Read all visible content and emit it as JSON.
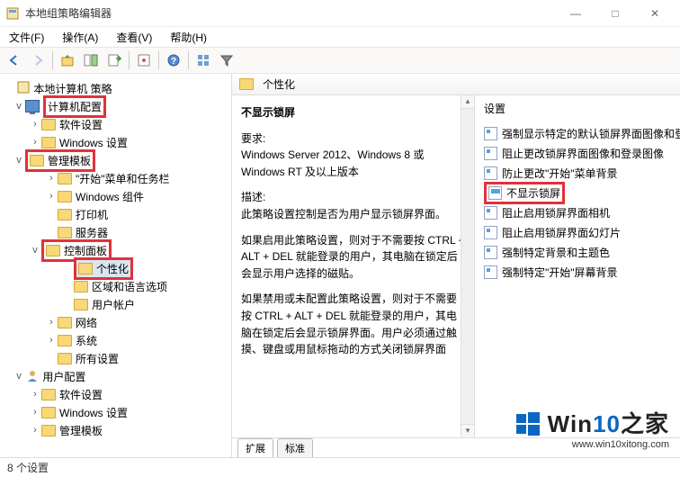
{
  "window": {
    "title": "本地组策略编辑器",
    "controls": {
      "min": "—",
      "max": "□",
      "close": "✕"
    }
  },
  "menu": {
    "file": "文件(F)",
    "action": "操作(A)",
    "view": "查看(V)",
    "help": "帮助(H)"
  },
  "tree": {
    "root": "本地计算机 策略",
    "computer_cfg": "计算机配置",
    "soft_settings": "软件设置",
    "win_settings": "Windows 设置",
    "admin_templates": "管理模板",
    "start_taskbar": "\"开始\"菜单和任务栏",
    "win_components": "Windows 组件",
    "printers": "打印机",
    "server": "服务器",
    "control_panel": "控制面板",
    "personalization": "个性化",
    "region_lang": "区域和语言选项",
    "user_accounts": "用户帐户",
    "network": "网络",
    "system": "系统",
    "all_settings": "所有设置",
    "user_cfg": "用户配置",
    "u_soft": "软件设置",
    "u_win": "Windows 设置",
    "u_admin": "管理模板"
  },
  "detail": {
    "header": "个性化",
    "title": "不显示锁屏",
    "req_label": "要求:",
    "req_text": "Windows Server 2012、Windows 8 或 Windows RT 及以上版本",
    "desc_label": "描述:",
    "desc_text": "此策略设置控制是否为用户显示锁屏界面。",
    "p1": "如果启用此策略设置，则对于不需要按 CTRL + ALT + DEL 就能登录的用户，其电脑在锁定后会显示用户选择的磁贴。",
    "p2": "如果禁用或未配置此策略设置，则对于不需要按 CTRL + ALT + DEL 就能登录的用户，其电脑在锁定后会显示锁屏界面。用户必须通过触摸、键盘或用鼠标拖动的方式关闭锁屏界面",
    "tabs": {
      "ext": "扩展",
      "std": "标准"
    }
  },
  "settings": {
    "header": "设置",
    "items": [
      "强制显示特定的默认锁屏界面图像和登录图像",
      "阻止更改锁屏界面图像和登录图像",
      "防止更改\"开始\"菜单背景",
      "不显示锁屏",
      "阻止启用锁屏界面相机",
      "阻止启用锁屏界面幻灯片",
      "强制特定背景和主题色",
      "强制特定\"开始\"屏幕背景"
    ]
  },
  "status": "8 个设置",
  "watermark": {
    "brand_a": "Win",
    "brand_b": "10",
    "brand_c": "之家",
    "url": "www.win10xitong.com"
  }
}
